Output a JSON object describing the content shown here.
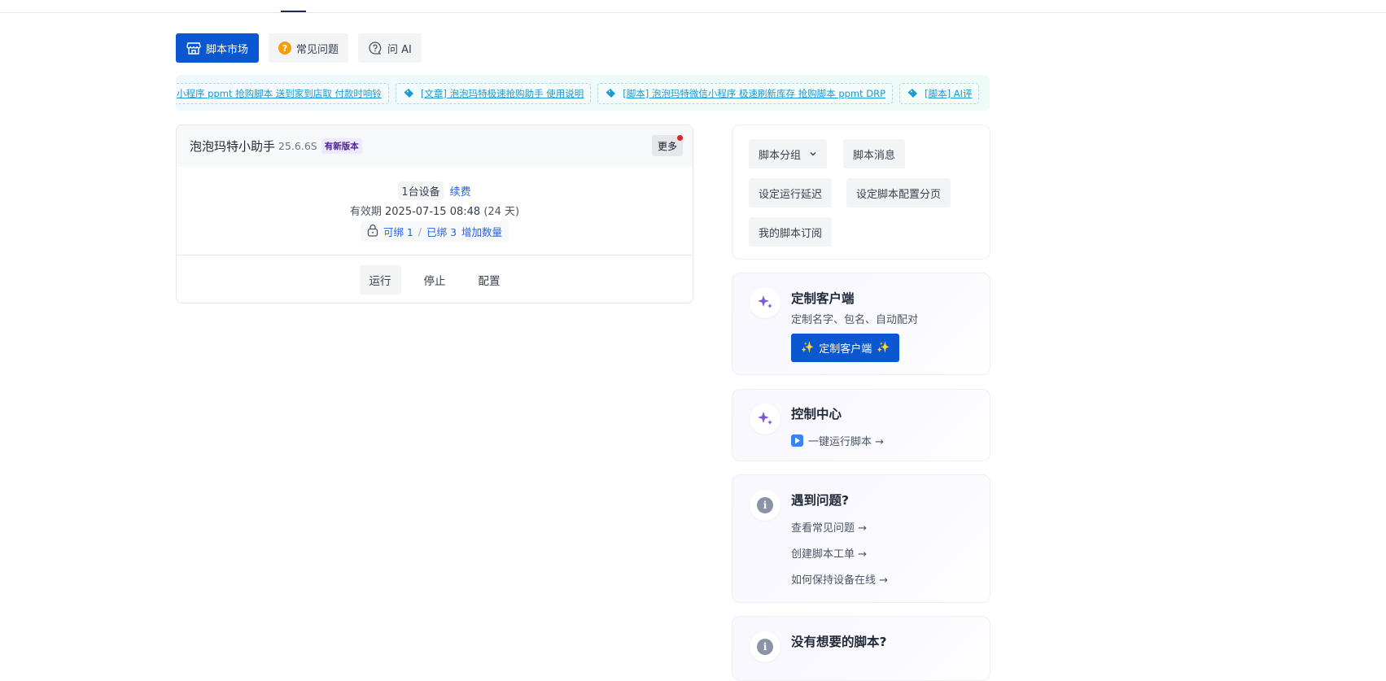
{
  "tabs": [
    {
      "label": "脚本市场",
      "icon": "store-icon"
    },
    {
      "label": "常见问题",
      "icon": "question-icon"
    },
    {
      "label": "问 AI",
      "icon": "chat-question-icon"
    }
  ],
  "ticker": [
    "小程序 ppmt 抢购脚本 送到家到店取 付款时响铃",
    "[文章] 泡泡玛特极速抢购助手 使用说明",
    "[脚本] 泡泡玛特微信小程序 极速刷新库存 抢购脚本 ppmt DRP",
    "[脚本] AI评"
  ],
  "script": {
    "title": "泡泡玛特小助手",
    "version": "25.6.6S",
    "badge": "有新版本",
    "more": "更多",
    "devices": "1台设备",
    "renew": "续费",
    "expiry_label": "有效期",
    "expiry_date": "2025-07-15 08:48",
    "expiry_days": "(24 天)",
    "bindable": "可绑 1",
    "bound": "已绑 3",
    "add_count": "增加数量",
    "actions": {
      "run": "运行",
      "stop": "停止",
      "config": "配置"
    }
  },
  "panel": {
    "group": "脚本分组",
    "messages": "脚本消息",
    "delay": "设定运行延迟",
    "paging": "设定脚本配置分页",
    "subs": "我的脚本订阅"
  },
  "custom_client": {
    "title": "定制客户端",
    "subtitle": "定制名字、包名、自动配对",
    "button": "定制客户端"
  },
  "control_center": {
    "title": "控制中心",
    "link": "一键运行脚本 →"
  },
  "problems": {
    "title": "遇到问题?",
    "links": [
      "查看常见问题 →",
      "创建脚本工单 →",
      "如何保持设备在线 →"
    ]
  },
  "no_script": {
    "title": "没有想要的脚本?"
  },
  "colors": {
    "primary": "#0b57d0",
    "link": "#2563eb",
    "ticker": "#1a9bd7",
    "accent": "#7c5cd6"
  }
}
